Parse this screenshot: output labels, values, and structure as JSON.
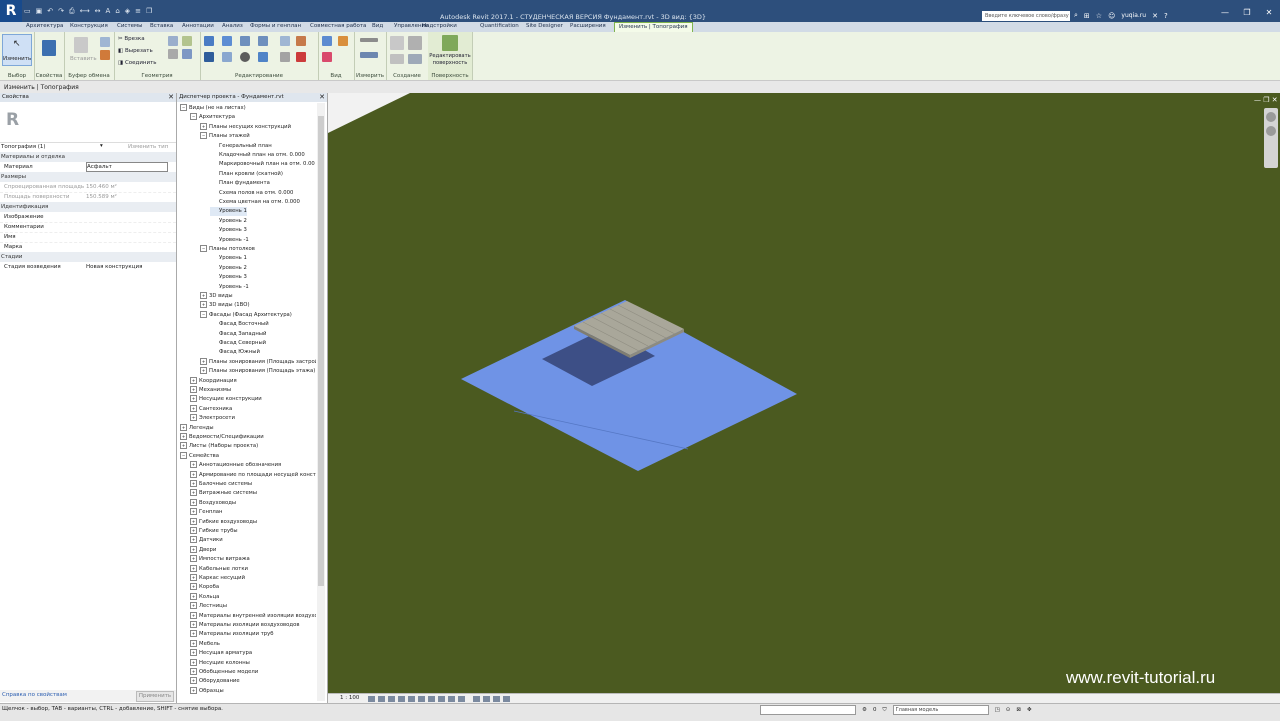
{
  "window": {
    "title": "Autodesk Revit 2017.1 - СТУДЕНЧЕСКАЯ ВЕРСИЯ    Фундамент.rvt - 3D вид: {3D}",
    "search_placeholder": "Введите ключевое слово/фразу",
    "user": "yuqia.ru"
  },
  "ribbon_tabs": [
    "Архитектура",
    "Конструкция",
    "Системы",
    "Вставка",
    "Аннотации",
    "Анализ",
    "Формы и генплан",
    "Совместная работа",
    "Вид",
    "Управление",
    "Надстройки",
    "Quantification",
    "Site Designer",
    "Расширения",
    "Изменить | Топография"
  ],
  "ribbon": {
    "modify_label": "Изменить",
    "select_label": "Выбор",
    "properties_label": "Свойства",
    "clipboard_label": "Буфер обмена",
    "paste_label": "Вставить",
    "geometry_label": "Геометрия",
    "cut_label": "Вырезать",
    "join_label": "Соединить",
    "cope_label": "Врезка",
    "modify_group_label": "Редактирование",
    "view_label": "Вид",
    "measure_label": "Измерить",
    "create_label": "Создание",
    "surface_label": "Поверхность",
    "edit_surface_label": "Редактировать поверхность"
  },
  "context_bar": "Изменить | Топография",
  "properties": {
    "title": "Свойства",
    "type_selector": "Топография (1)",
    "edit_type": "Изменить тип",
    "rows": [
      {
        "k": "Материалы и отделка",
        "v": "",
        "head": true
      },
      {
        "k": "Материал",
        "v": "Асфальт"
      },
      {
        "k": "Размеры",
        "v": "",
        "head": true
      },
      {
        "k": "Спроецированная площадь",
        "v": "150.460 м²",
        "dim": true
      },
      {
        "k": "Площадь поверхности",
        "v": "150.589 м²",
        "dim": true
      },
      {
        "k": "Идентификация",
        "v": "",
        "head": true
      },
      {
        "k": "Изображение",
        "v": ""
      },
      {
        "k": "Комментарии",
        "v": ""
      },
      {
        "k": "Имя",
        "v": ""
      },
      {
        "k": "Марка",
        "v": ""
      },
      {
        "k": "Стадии",
        "v": "",
        "head": true
      },
      {
        "k": "Стадия возведения",
        "v": "Новая конструкция"
      },
      {
        "k": "Стадия сноса",
        "v": "Нет"
      }
    ],
    "help_link": "Справка по свойствам",
    "apply": "Применить"
  },
  "browser": {
    "title": "Диспетчер проекта - Фундамент.rvt",
    "items": [
      {
        "t": "Виды (не на листах)",
        "l": 0,
        "pm": "−"
      },
      {
        "t": "Архитектура",
        "l": 1,
        "pm": "−"
      },
      {
        "t": "Планы несущих конструкций",
        "l": 2,
        "pm": "+"
      },
      {
        "t": "Планы этажей",
        "l": 2,
        "pm": "−"
      },
      {
        "t": "Генеральный план",
        "l": 3
      },
      {
        "t": "Кладочный план на отм. 0.000",
        "l": 3
      },
      {
        "t": "Маркировочный план на отм. 0.00",
        "l": 3
      },
      {
        "t": "План кровли (скатной)",
        "l": 3
      },
      {
        "t": "План фундамента",
        "l": 3
      },
      {
        "t": "Схема полов на отм. 0.000",
        "l": 3
      },
      {
        "t": "Схема цветная на отм. 0.000",
        "l": 3
      },
      {
        "t": "Уровень 1",
        "l": 3,
        "sel": true
      },
      {
        "t": "Уровень 2",
        "l": 3
      },
      {
        "t": "Уровень 3",
        "l": 3
      },
      {
        "t": "Уровень -1",
        "l": 3
      },
      {
        "t": "Планы потолков",
        "l": 2,
        "pm": "−"
      },
      {
        "t": "Уровень 1",
        "l": 3
      },
      {
        "t": "Уровень 2",
        "l": 3
      },
      {
        "t": "Уровень 3",
        "l": 3
      },
      {
        "t": "Уровень -1",
        "l": 3
      },
      {
        "t": "3D виды",
        "l": 2,
        "pm": "+"
      },
      {
        "t": "3D виды (1ВО)",
        "l": 2,
        "pm": "+"
      },
      {
        "t": "Фасады (Фасад Архитектура)",
        "l": 2,
        "pm": "−"
      },
      {
        "t": "Фасад Восточный",
        "l": 3
      },
      {
        "t": "Фасад Западный",
        "l": 3
      },
      {
        "t": "Фасад Северный",
        "l": 3
      },
      {
        "t": "Фасад Южный",
        "l": 3
      },
      {
        "t": "Планы зонирования (Площадь застрой",
        "l": 2,
        "pm": "+"
      },
      {
        "t": "Планы зонирования (Площадь этажа)",
        "l": 2,
        "pm": "+"
      },
      {
        "t": "Координация",
        "l": 1,
        "pm": "+"
      },
      {
        "t": "Механизмы",
        "l": 1,
        "pm": "+"
      },
      {
        "t": "Несущие конструкции",
        "l": 1,
        "pm": "+"
      },
      {
        "t": "Сантехника",
        "l": 1,
        "pm": "+"
      },
      {
        "t": "Электросети",
        "l": 1,
        "pm": "+"
      },
      {
        "t": "Легенды",
        "l": 0,
        "pm": "+"
      },
      {
        "t": "Ведомости/Спецификации",
        "l": 0,
        "pm": "+"
      },
      {
        "t": "Листы (Наборы проекта)",
        "l": 0,
        "pm": "+"
      },
      {
        "t": "Семейства",
        "l": 0,
        "pm": "−"
      },
      {
        "t": "Аннотационные обозначения",
        "l": 1,
        "pm": "+"
      },
      {
        "t": "Армирование по площади несущей конст",
        "l": 1,
        "pm": "+"
      },
      {
        "t": "Балочные системы",
        "l": 1,
        "pm": "+"
      },
      {
        "t": "Витражные системы",
        "l": 1,
        "pm": "+"
      },
      {
        "t": "Воздуховоды",
        "l": 1,
        "pm": "+"
      },
      {
        "t": "Генплан",
        "l": 1,
        "pm": "+"
      },
      {
        "t": "Гибкие воздуховоды",
        "l": 1,
        "pm": "+"
      },
      {
        "t": "Гибкие трубы",
        "l": 1,
        "pm": "+"
      },
      {
        "t": "Датчики",
        "l": 1,
        "pm": "+"
      },
      {
        "t": "Двери",
        "l": 1,
        "pm": "+"
      },
      {
        "t": "Импосты витража",
        "l": 1,
        "pm": "+"
      },
      {
        "t": "Кабельные лотки",
        "l": 1,
        "pm": "+"
      },
      {
        "t": "Каркас несущий",
        "l": 1,
        "pm": "+"
      },
      {
        "t": "Короба",
        "l": 1,
        "pm": "+"
      },
      {
        "t": "Кольца",
        "l": 1,
        "pm": "+"
      },
      {
        "t": "Лестницы",
        "l": 1,
        "pm": "+"
      },
      {
        "t": "Материалы внутренней изоляции воздухо",
        "l": 1,
        "pm": "+"
      },
      {
        "t": "Материалы изоляции воздуховодов",
        "l": 1,
        "pm": "+"
      },
      {
        "t": "Материалы изоляции труб",
        "l": 1,
        "pm": "+"
      },
      {
        "t": "Мебель",
        "l": 1,
        "pm": "+"
      },
      {
        "t": "Несущая арматура",
        "l": 1,
        "pm": "+"
      },
      {
        "t": "Несущие колонны",
        "l": 1,
        "pm": "+"
      },
      {
        "t": "Обобщенные модели",
        "l": 1,
        "pm": "+"
      },
      {
        "t": "Оборудование",
        "l": 1,
        "pm": "+"
      },
      {
        "t": "Образцы",
        "l": 1,
        "pm": "+"
      }
    ]
  },
  "viewport": {
    "scale": "1 : 100",
    "watermark": "www.revit-tutorial.ru",
    "colors": {
      "grass": "#4b5a20",
      "topo": "#6f93e6",
      "slab": "#a9a79a",
      "shadow": "#3d4f86"
    }
  },
  "statusbar": {
    "text": "Щелчок - выбор, TAB - варианты, CTRL - добавление, SHIFT - снятие выбора.",
    "value": "0",
    "model": "Главная модель"
  }
}
